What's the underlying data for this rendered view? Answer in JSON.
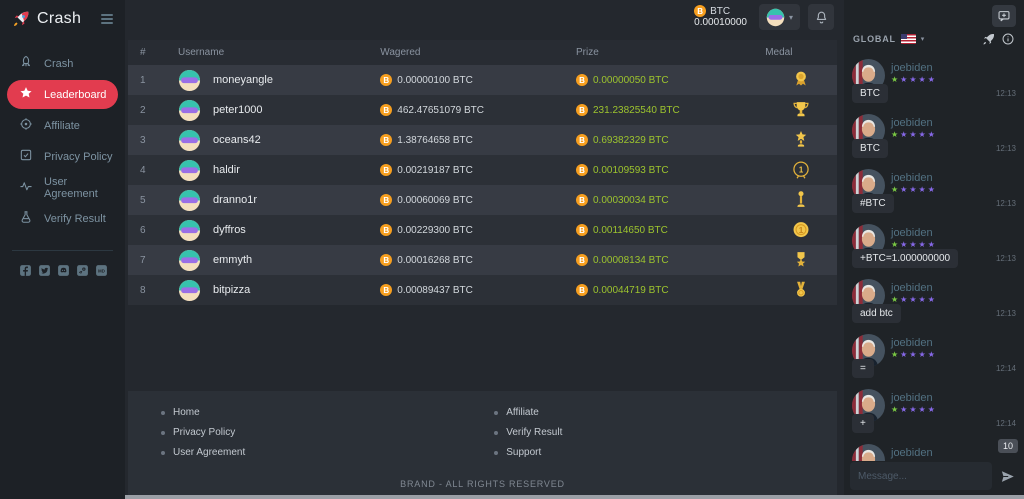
{
  "brand": {
    "name": "Crash"
  },
  "topbar": {
    "balance_currency": "BTC",
    "balance_amount": "0.00010000"
  },
  "sidebar": {
    "items": [
      {
        "label": "Crash",
        "icon": "rocket",
        "active": false
      },
      {
        "label": "Leaderboard",
        "icon": "star",
        "active": true
      },
      {
        "label": "Affiliate",
        "icon": "target",
        "active": false
      },
      {
        "label": "Privacy Policy",
        "icon": "checkbox",
        "active": false
      },
      {
        "label": "User Agreement",
        "icon": "pulse",
        "active": false
      },
      {
        "label": "Verify Result",
        "icon": "flask",
        "active": false
      }
    ],
    "social": [
      {
        "name": "facebook"
      },
      {
        "name": "twitter"
      },
      {
        "name": "discord"
      },
      {
        "name": "steam"
      },
      {
        "name": "medium"
      }
    ]
  },
  "table": {
    "columns": [
      "#",
      "Username",
      "Wagered",
      "Prize",
      "Medal"
    ],
    "rows": [
      {
        "rank": "1",
        "username": "moneyangle",
        "wagered": "0.00000100 BTC",
        "prize": "0.00000050 BTC",
        "medal": "rosette"
      },
      {
        "rank": "2",
        "username": "peter1000",
        "wagered": "462.47651079 BTC",
        "prize": "231.23825540 BTC",
        "medal": "trophy"
      },
      {
        "rank": "3",
        "username": "oceans42",
        "wagered": "1.38764658 BTC",
        "prize": "0.69382329 BTC",
        "medal": "star-trophy"
      },
      {
        "rank": "4",
        "username": "haldir",
        "wagered": "0.00219187 BTC",
        "prize": "0.00109593 BTC",
        "medal": "circle-one"
      },
      {
        "rank": "5",
        "username": "dranno1r",
        "wagered": "0.00060069 BTC",
        "prize": "0.00030034 BTC",
        "medal": "column-trophy"
      },
      {
        "rank": "6",
        "username": "dyffros",
        "wagered": "0.00229300 BTC",
        "prize": "0.00114650 BTC",
        "medal": "gold-coin"
      },
      {
        "rank": "7",
        "username": "emmyth",
        "wagered": "0.00016268 BTC",
        "prize": "0.00008134 BTC",
        "medal": "military-medal"
      },
      {
        "rank": "8",
        "username": "bitpizza",
        "wagered": "0.00089437 BTC",
        "prize": "0.00044719 BTC",
        "medal": "ribbon-medal"
      }
    ]
  },
  "footer": {
    "links_left": [
      "Home",
      "Privacy Policy",
      "User Agreement"
    ],
    "links_right": [
      "Affiliate",
      "Verify Result",
      "Support"
    ],
    "copyright": "BRAND - ALL RIGHTS RESERVED"
  },
  "chat": {
    "channel": "GLOBAL",
    "flag": "us-flag",
    "unread_badge": "10",
    "input_placeholder": "Message...",
    "messages": [
      {
        "user": "joebiden",
        "text": "BTC",
        "time": "12:13",
        "stars_green": 1,
        "stars_purple": 4
      },
      {
        "user": "joebiden",
        "text": "BTC",
        "time": "12:13",
        "stars_green": 1,
        "stars_purple": 4
      },
      {
        "user": "joebiden",
        "text": "#BTC",
        "time": "12:13",
        "stars_green": 1,
        "stars_purple": 4
      },
      {
        "user": "joebiden",
        "text": "+BTC=1.000000000",
        "time": "12:13",
        "stars_green": 1,
        "stars_purple": 4
      },
      {
        "user": "joebiden",
        "text": "add btc",
        "time": "12:13",
        "stars_green": 1,
        "stars_purple": 4
      },
      {
        "user": "joebiden",
        "text": "=",
        "time": "12:14",
        "stars_green": 1,
        "stars_purple": 4
      },
      {
        "user": "joebiden",
        "text": "+",
        "time": "12:14",
        "stars_green": 1,
        "stars_purple": 4
      },
      {
        "user": "joebiden",
        "text": null,
        "time": null,
        "stars_green": 1,
        "stars_purple": 4,
        "partial": true
      }
    ]
  },
  "colors": {
    "accent_red": "#e23c4f",
    "prize_green": "#9dc42e",
    "coin_orange": "#f79f1f",
    "star_green": "#7ac943",
    "star_purple": "#8668e8",
    "medal_gold": "#f2c64b"
  }
}
